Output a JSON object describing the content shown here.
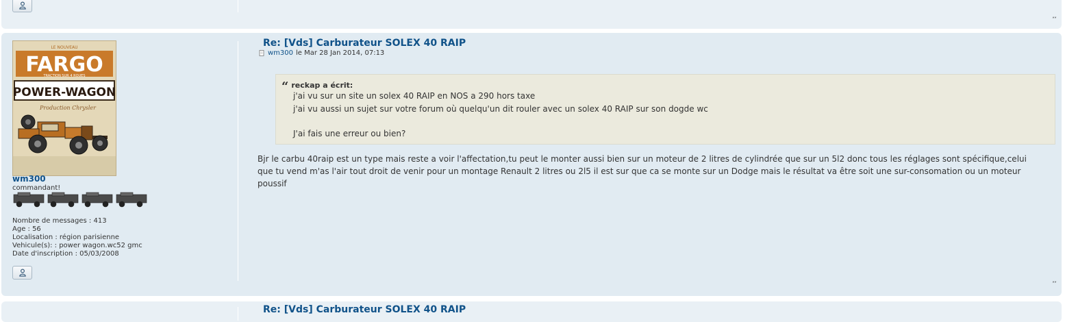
{
  "posts": {
    "current": {
      "title": "Re: [Vds] Carburateur SOLEX 40 RAIP",
      "author": "wm300",
      "date_text": "le Mar 28 Jan 2014, 07:13",
      "author_rank": "commandant!",
      "profile": [
        "Nombre de messages : 413",
        "Age : 56",
        "Localisation : région parisienne",
        "Vehicule(s): : power wagon.wc52 gmc",
        "Date d'inscription : 05/03/2008"
      ],
      "avatar": {
        "top_text": "LE NOUVEAU",
        "brand": "FARGO",
        "subtitle": "TRACTION SUR 4 ROUES",
        "model": "POWER-WAGON",
        "tagline": "Production Chrysler"
      },
      "quote": {
        "cite": "reckap a écrit:",
        "lines": [
          "j'ai vu sur un site un solex 40 RAIP en NOS a 290 hors taxe",
          "j'ai vu aussi un sujet sur votre forum où quelqu'un dit rouler avec un solex 40 RAIP sur son dogde wc",
          "",
          "J'ai fais une erreur ou bien?"
        ]
      },
      "body": "Bjr le carbu 40raip est un type mais reste a voir l'affectation,tu peut le monter aussi bien sur un moteur de 2 litres de cylindrée que sur un 5l2 donc tous les réglages sont spécifique,celui que tu vend m'as l'air tout droit de venir pour un montage Renault 2 litres ou 2l5 il est sur que ca se monte sur un Dodge mais le résultat va être soit une sur-consomation ou un moteur poussif"
    },
    "next": {
      "title": "Re: [Vds] Carburateur SOLEX 40 RAIP"
    }
  },
  "icons": {
    "profile": "user-profile-icon",
    "post": "post-icon",
    "top": "back-to-top-icon",
    "back_to_top_glyph": "˄˅"
  },
  "colors": {
    "post_bg": "#e1ebf2",
    "alt_post_bg": "#e9f0f5",
    "link": "#105289",
    "quote_bg": "#ebeadd"
  }
}
